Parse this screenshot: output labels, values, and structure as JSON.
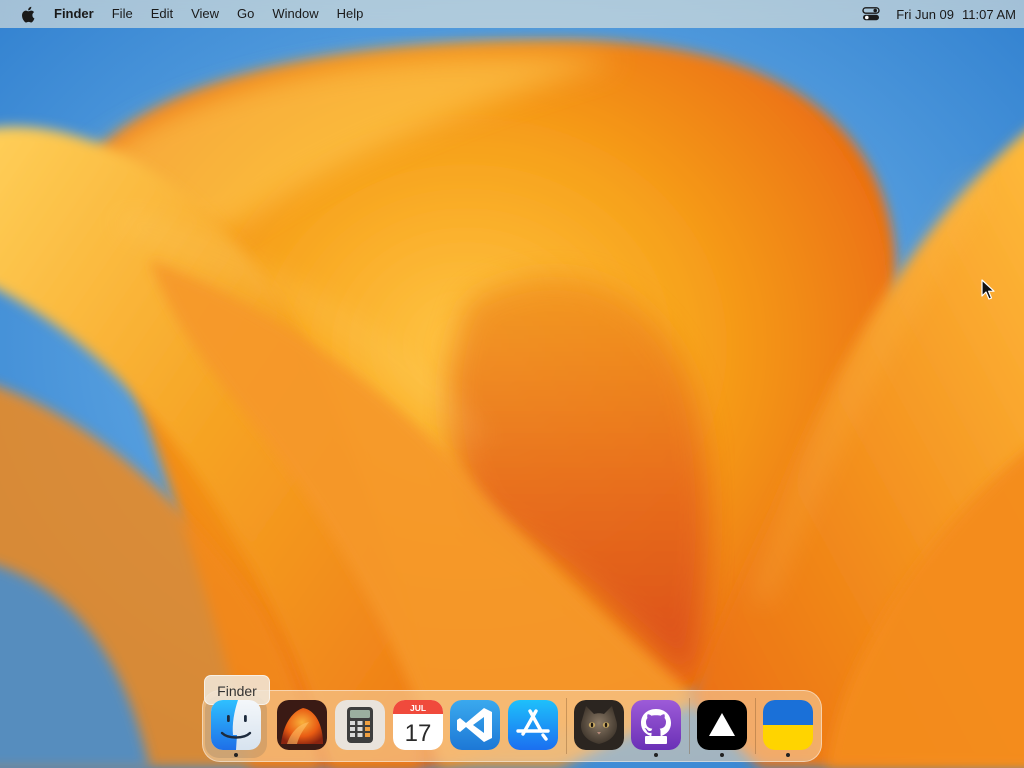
{
  "menubar": {
    "apple_icon": "apple-logo-icon",
    "app_name": "Finder",
    "menus": [
      "File",
      "Edit",
      "View",
      "Go",
      "Window",
      "Help"
    ],
    "control_center_icon": "control-center-icon",
    "date": "Fri Jun 09",
    "time": "11:07 AM"
  },
  "dock": {
    "tooltip": "Finder",
    "apps": [
      {
        "icon": "finder-icon",
        "running": true
      },
      {
        "icon": "macos-ventura-icon",
        "running": false
      },
      {
        "icon": "calculator-icon",
        "running": false
      },
      {
        "icon": "calendar-icon",
        "running": false,
        "month": "JUL",
        "day": "17"
      },
      {
        "icon": "vscode-icon",
        "running": false
      },
      {
        "icon": "app-store-icon",
        "running": false
      },
      {
        "icon": "cat-photo-icon",
        "running": false
      },
      {
        "icon": "github-icon",
        "running": true
      },
      {
        "icon": "triangle-app-icon",
        "running": true
      },
      {
        "icon": "ukraine-flag-icon",
        "running": true
      }
    ]
  },
  "colors": {
    "wallpaper_orange": "#f7a21b",
    "wallpaper_blue": "#3d8fd6",
    "accent_blue": "#1e78e6"
  }
}
